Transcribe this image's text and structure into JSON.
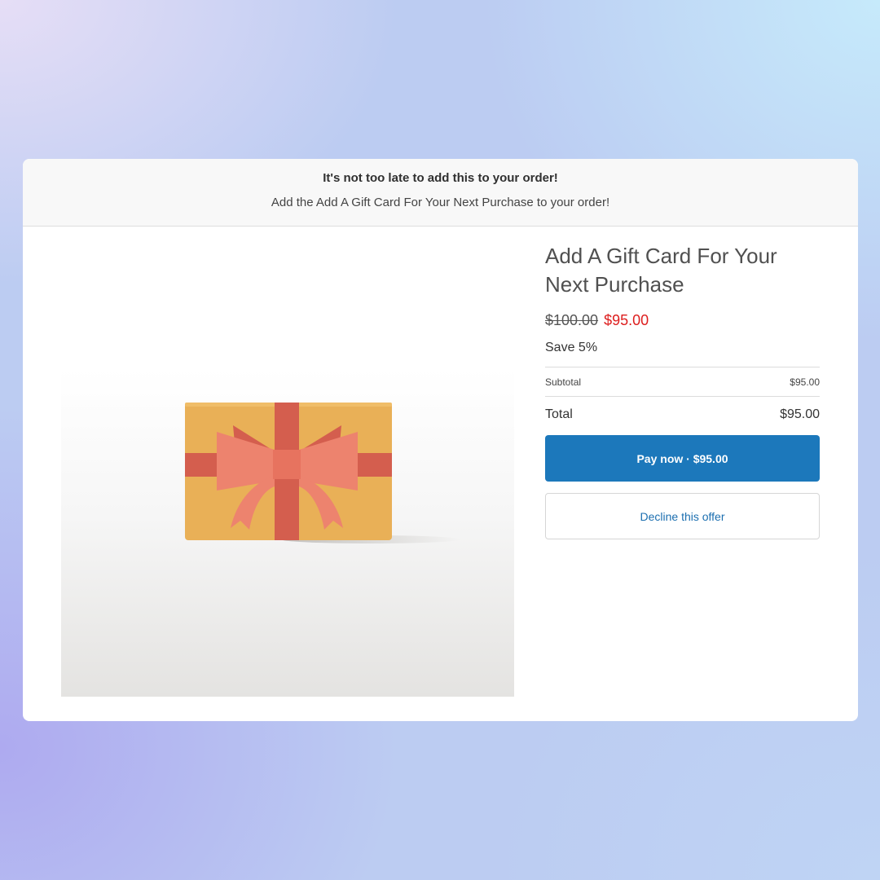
{
  "banner": {
    "title": "It's not too late to add this to your order!",
    "subtitle": "Add the Add A Gift Card For Your Next Purchase to your order!"
  },
  "product": {
    "title": "Add A Gift Card For Your Next Purchase",
    "image_icon": "gift-card-icon",
    "price_original": "$100.00",
    "price_sale": "$95.00",
    "savings": "Save 5%"
  },
  "summary": {
    "subtotal_label": "Subtotal",
    "subtotal_value": "$95.00",
    "total_label": "Total",
    "total_value": "$95.00"
  },
  "actions": {
    "pay_label": "Pay now · $95.00",
    "decline_label": "Decline this offer"
  },
  "colors": {
    "accent": "#1c78bb",
    "sale_price": "#dd1d1d",
    "card_gold": "#e9b057",
    "ribbon": "#d45e4e",
    "bow": "#ed836e"
  }
}
